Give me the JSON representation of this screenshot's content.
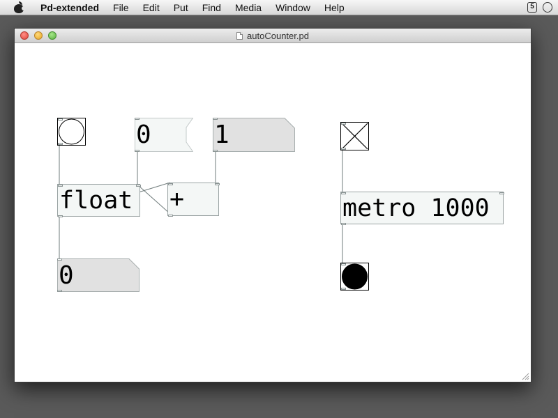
{
  "menubar": {
    "app_name": "Pd-extended",
    "items": [
      "File",
      "Edit",
      "Put",
      "Find",
      "Media",
      "Window",
      "Help"
    ],
    "status_icon_1": "5"
  },
  "window": {
    "title": "autoCounter.pd"
  },
  "patch": {
    "float_object": "float",
    "plus_object": "+",
    "metro_object": "metro 1000",
    "message_zero": "0",
    "number_one": "1",
    "number_output": "0",
    "toggle_state": "on",
    "bang_left_state": "off",
    "bang_right_state": "flashing"
  },
  "colors": {
    "object_fill": "#f4f7f6",
    "atom_fill": "#e1e1e1",
    "border": "#9aa3a3",
    "wire": "#6f7b7b"
  },
  "icons": {
    "apple": "apple-logo-icon",
    "file": "document-icon",
    "resize": "resize-grip-icon"
  }
}
